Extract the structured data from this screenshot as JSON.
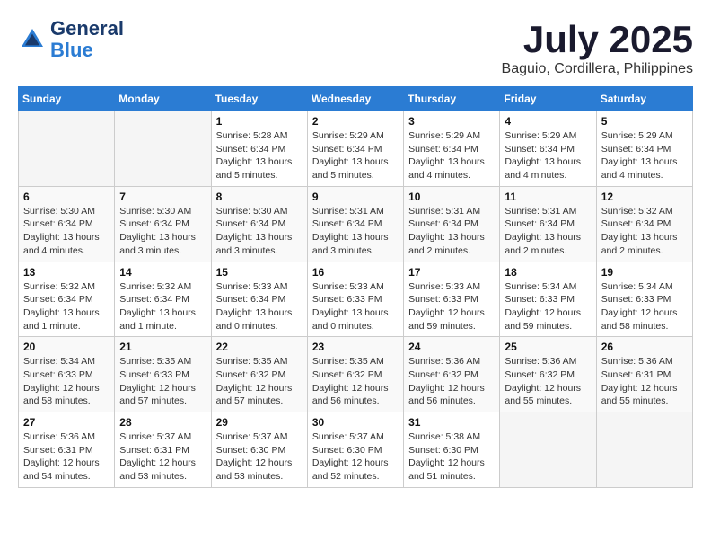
{
  "logo": {
    "text_general": "General",
    "text_blue": "Blue"
  },
  "title": "July 2025",
  "location": "Baguio, Cordillera, Philippines",
  "weekdays": [
    "Sunday",
    "Monday",
    "Tuesday",
    "Wednesday",
    "Thursday",
    "Friday",
    "Saturday"
  ],
  "weeks": [
    [
      {
        "day": "",
        "info": ""
      },
      {
        "day": "",
        "info": ""
      },
      {
        "day": "1",
        "info": "Sunrise: 5:28 AM\nSunset: 6:34 PM\nDaylight: 13 hours and 5 minutes."
      },
      {
        "day": "2",
        "info": "Sunrise: 5:29 AM\nSunset: 6:34 PM\nDaylight: 13 hours and 5 minutes."
      },
      {
        "day": "3",
        "info": "Sunrise: 5:29 AM\nSunset: 6:34 PM\nDaylight: 13 hours and 4 minutes."
      },
      {
        "day": "4",
        "info": "Sunrise: 5:29 AM\nSunset: 6:34 PM\nDaylight: 13 hours and 4 minutes."
      },
      {
        "day": "5",
        "info": "Sunrise: 5:29 AM\nSunset: 6:34 PM\nDaylight: 13 hours and 4 minutes."
      }
    ],
    [
      {
        "day": "6",
        "info": "Sunrise: 5:30 AM\nSunset: 6:34 PM\nDaylight: 13 hours and 4 minutes."
      },
      {
        "day": "7",
        "info": "Sunrise: 5:30 AM\nSunset: 6:34 PM\nDaylight: 13 hours and 3 minutes."
      },
      {
        "day": "8",
        "info": "Sunrise: 5:30 AM\nSunset: 6:34 PM\nDaylight: 13 hours and 3 minutes."
      },
      {
        "day": "9",
        "info": "Sunrise: 5:31 AM\nSunset: 6:34 PM\nDaylight: 13 hours and 3 minutes."
      },
      {
        "day": "10",
        "info": "Sunrise: 5:31 AM\nSunset: 6:34 PM\nDaylight: 13 hours and 2 minutes."
      },
      {
        "day": "11",
        "info": "Sunrise: 5:31 AM\nSunset: 6:34 PM\nDaylight: 13 hours and 2 minutes."
      },
      {
        "day": "12",
        "info": "Sunrise: 5:32 AM\nSunset: 6:34 PM\nDaylight: 13 hours and 2 minutes."
      }
    ],
    [
      {
        "day": "13",
        "info": "Sunrise: 5:32 AM\nSunset: 6:34 PM\nDaylight: 13 hours and 1 minute."
      },
      {
        "day": "14",
        "info": "Sunrise: 5:32 AM\nSunset: 6:34 PM\nDaylight: 13 hours and 1 minute."
      },
      {
        "day": "15",
        "info": "Sunrise: 5:33 AM\nSunset: 6:34 PM\nDaylight: 13 hours and 0 minutes."
      },
      {
        "day": "16",
        "info": "Sunrise: 5:33 AM\nSunset: 6:33 PM\nDaylight: 13 hours and 0 minutes."
      },
      {
        "day": "17",
        "info": "Sunrise: 5:33 AM\nSunset: 6:33 PM\nDaylight: 12 hours and 59 minutes."
      },
      {
        "day": "18",
        "info": "Sunrise: 5:34 AM\nSunset: 6:33 PM\nDaylight: 12 hours and 59 minutes."
      },
      {
        "day": "19",
        "info": "Sunrise: 5:34 AM\nSunset: 6:33 PM\nDaylight: 12 hours and 58 minutes."
      }
    ],
    [
      {
        "day": "20",
        "info": "Sunrise: 5:34 AM\nSunset: 6:33 PM\nDaylight: 12 hours and 58 minutes."
      },
      {
        "day": "21",
        "info": "Sunrise: 5:35 AM\nSunset: 6:33 PM\nDaylight: 12 hours and 57 minutes."
      },
      {
        "day": "22",
        "info": "Sunrise: 5:35 AM\nSunset: 6:32 PM\nDaylight: 12 hours and 57 minutes."
      },
      {
        "day": "23",
        "info": "Sunrise: 5:35 AM\nSunset: 6:32 PM\nDaylight: 12 hours and 56 minutes."
      },
      {
        "day": "24",
        "info": "Sunrise: 5:36 AM\nSunset: 6:32 PM\nDaylight: 12 hours and 56 minutes."
      },
      {
        "day": "25",
        "info": "Sunrise: 5:36 AM\nSunset: 6:32 PM\nDaylight: 12 hours and 55 minutes."
      },
      {
        "day": "26",
        "info": "Sunrise: 5:36 AM\nSunset: 6:31 PM\nDaylight: 12 hours and 55 minutes."
      }
    ],
    [
      {
        "day": "27",
        "info": "Sunrise: 5:36 AM\nSunset: 6:31 PM\nDaylight: 12 hours and 54 minutes."
      },
      {
        "day": "28",
        "info": "Sunrise: 5:37 AM\nSunset: 6:31 PM\nDaylight: 12 hours and 53 minutes."
      },
      {
        "day": "29",
        "info": "Sunrise: 5:37 AM\nSunset: 6:30 PM\nDaylight: 12 hours and 53 minutes."
      },
      {
        "day": "30",
        "info": "Sunrise: 5:37 AM\nSunset: 6:30 PM\nDaylight: 12 hours and 52 minutes."
      },
      {
        "day": "31",
        "info": "Sunrise: 5:38 AM\nSunset: 6:30 PM\nDaylight: 12 hours and 51 minutes."
      },
      {
        "day": "",
        "info": ""
      },
      {
        "day": "",
        "info": ""
      }
    ]
  ]
}
